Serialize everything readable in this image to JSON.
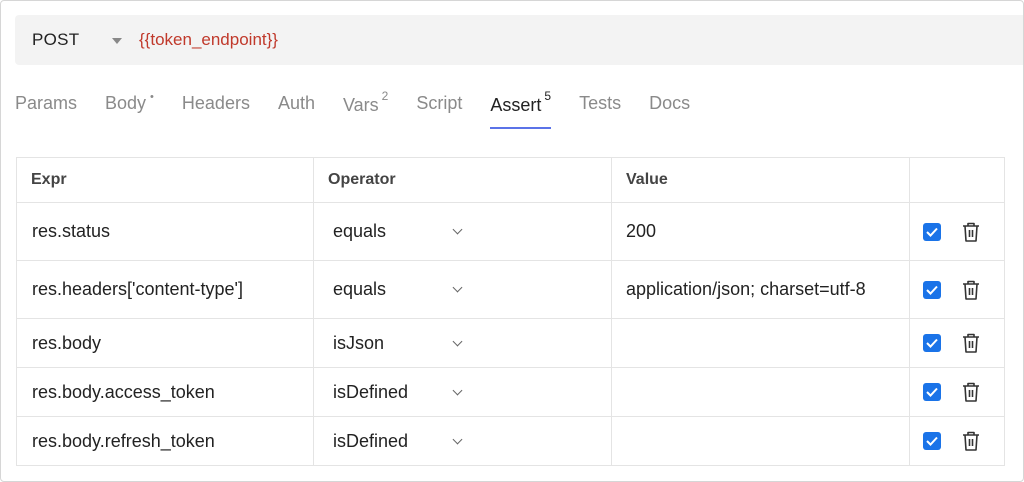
{
  "request": {
    "method": "POST",
    "url": "{{token_endpoint}}"
  },
  "tabs": [
    {
      "label": "Params",
      "badge": "",
      "active": false
    },
    {
      "label": "Body",
      "badge": "•",
      "active": false
    },
    {
      "label": "Headers",
      "badge": "",
      "active": false
    },
    {
      "label": "Auth",
      "badge": "",
      "active": false
    },
    {
      "label": "Vars",
      "badge": "2",
      "active": false
    },
    {
      "label": "Script",
      "badge": "",
      "active": false
    },
    {
      "label": "Assert",
      "badge": "5",
      "active": true
    },
    {
      "label": "Tests",
      "badge": "",
      "active": false
    },
    {
      "label": "Docs",
      "badge": "",
      "active": false
    }
  ],
  "table": {
    "headers": {
      "expr": "Expr",
      "operator": "Operator",
      "value": "Value"
    },
    "rows": [
      {
        "expr": "res.status",
        "operator": "equals",
        "value": "200",
        "enabled": true
      },
      {
        "expr": "res.headers['content-type']",
        "operator": "equals",
        "value": "application/json; charset=utf-8",
        "enabled": true
      },
      {
        "expr": "res.body",
        "operator": "isJson",
        "value": "",
        "enabled": true
      },
      {
        "expr": "res.body.access_token",
        "operator": "isDefined",
        "value": "",
        "enabled": true
      },
      {
        "expr": "res.body.refresh_token",
        "operator": "isDefined",
        "value": "",
        "enabled": true
      }
    ]
  },
  "colors": {
    "accent": "#5b73e8",
    "checkbox": "#1a73e8",
    "url": "#c0392b"
  },
  "icons": {
    "method_caret": "caret-down-icon",
    "operator_chevron": "chevron-down-icon",
    "delete": "trash-icon",
    "enabled": "checkbox-checked-icon"
  }
}
